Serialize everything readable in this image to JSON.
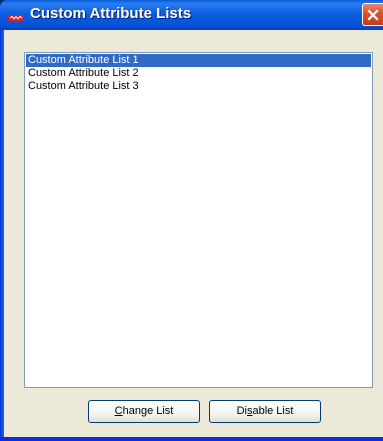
{
  "window": {
    "title": "Custom Attribute Lists",
    "icon": "red-app-icon",
    "close_icon": "close-x-icon"
  },
  "list": {
    "items": [
      {
        "label": "Custom Attribute List 1",
        "selected": true
      },
      {
        "label": "Custom Attribute List 2",
        "selected": false
      },
      {
        "label": "Custom Attribute List 3",
        "selected": false
      }
    ]
  },
  "buttons": {
    "change": {
      "mnemonic": "C",
      "rest": "hange List"
    },
    "disable": {
      "pre": "Di",
      "mnemonic": "s",
      "rest": "able List"
    }
  },
  "colors": {
    "titlebar": "#0552d6",
    "selection": "#316ac5",
    "dialog_face": "#ece9d8",
    "close_button": "#d8542e"
  }
}
